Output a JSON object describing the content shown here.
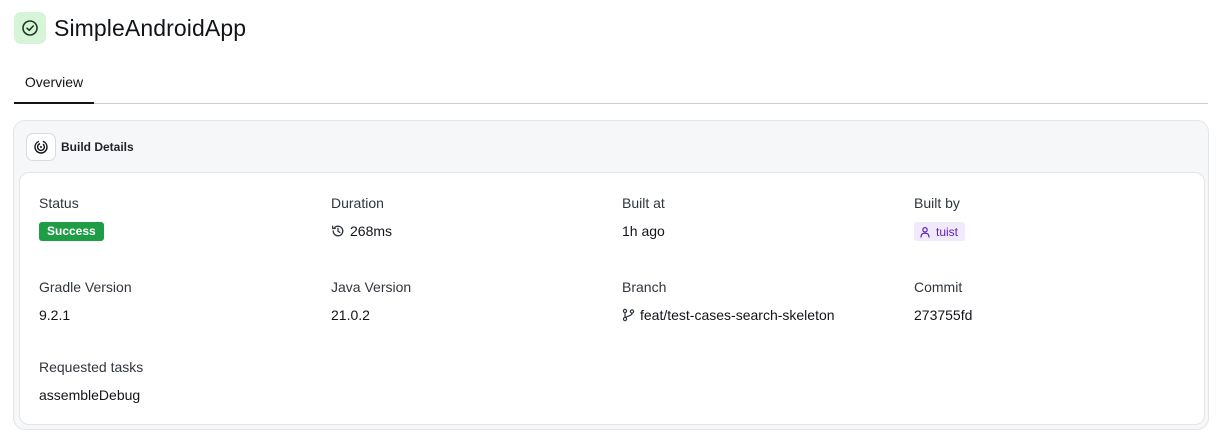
{
  "app": {
    "title": "SimpleAndroidApp",
    "icon": "check-circle-icon",
    "icon_bg": "#d6f5d8",
    "icon_color": "#1b6b2c"
  },
  "tabs": [
    {
      "label": "Overview",
      "active": true
    }
  ],
  "build_details": {
    "title": "Build Details",
    "icon": "build-swirl-icon",
    "status": {
      "label": "Status",
      "value": "Success",
      "color": "#1f9d45"
    },
    "duration": {
      "label": "Duration",
      "value": "268ms",
      "icon": "history-icon"
    },
    "built_at": {
      "label": "Built at",
      "value": "1h ago"
    },
    "built_by": {
      "label": "Built by",
      "value": "tuist",
      "icon": "user-icon",
      "color": "#5b21b6"
    },
    "gradle_version": {
      "label": "Gradle Version",
      "value": "9.2.1"
    },
    "java_version": {
      "label": "Java Version",
      "value": "21.0.2"
    },
    "branch": {
      "label": "Branch",
      "value": "feat/test-cases-search-skeleton",
      "icon": "git-branch-icon"
    },
    "commit": {
      "label": "Commit",
      "value": "273755fd"
    },
    "requested_tasks": {
      "label": "Requested tasks",
      "value": "assembleDebug"
    }
  }
}
